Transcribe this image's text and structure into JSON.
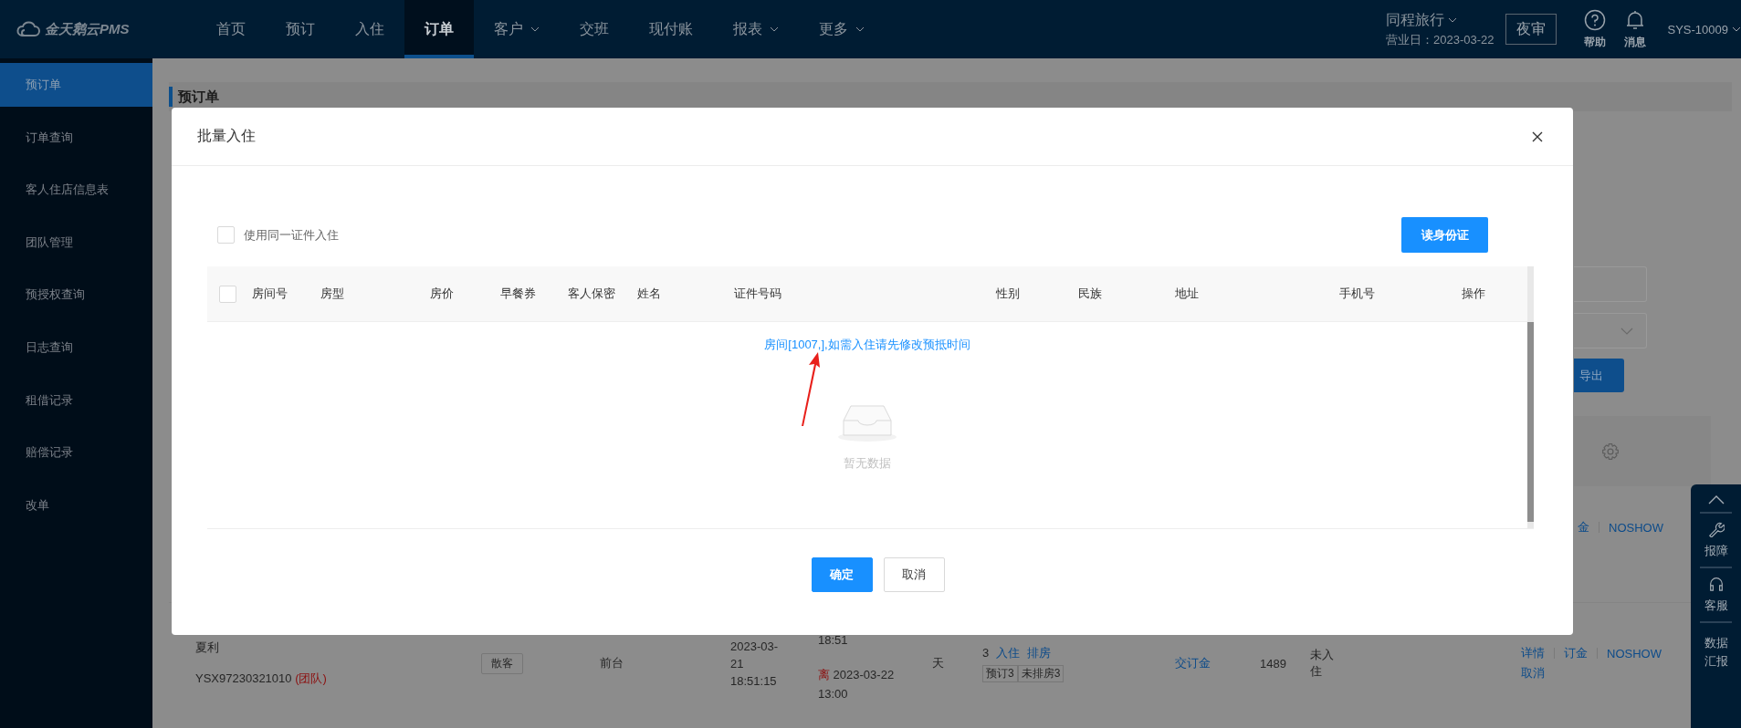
{
  "top_bar": {
    "logo": "金天鹅云PMS",
    "nav": [
      {
        "label": "首页",
        "selected": false,
        "has_menu": false
      },
      {
        "label": "预订",
        "selected": false,
        "has_menu": false
      },
      {
        "label": "入住",
        "selected": false,
        "has_menu": false
      },
      {
        "label": "订单",
        "selected": true,
        "has_menu": false
      },
      {
        "label": "客户",
        "selected": false,
        "has_menu": true
      },
      {
        "label": "交班",
        "selected": false,
        "has_menu": false
      },
      {
        "label": "现付账",
        "selected": false,
        "has_menu": false
      },
      {
        "label": "报表",
        "selected": false,
        "has_menu": true
      },
      {
        "label": "更多",
        "selected": false,
        "has_menu": true
      }
    ],
    "hotel": "同程旅行",
    "business_date": "营业日：2023-03-22",
    "night_audit_button": "夜审",
    "help": "帮助",
    "messages": "消息",
    "user": "SYS-10009"
  },
  "sidebar": {
    "items": [
      {
        "label": "预订单",
        "selected": true
      },
      {
        "label": "订单查询",
        "selected": false
      },
      {
        "label": "客人住店信息表",
        "selected": false
      },
      {
        "label": "团队管理",
        "selected": false
      },
      {
        "label": "预授权查询",
        "selected": false
      },
      {
        "label": "日志查询",
        "selected": false
      },
      {
        "label": "租借记录",
        "selected": false
      },
      {
        "label": "赔偿记录",
        "selected": false
      },
      {
        "label": "改单",
        "selected": false
      }
    ]
  },
  "page": {
    "title": "预订单",
    "export_button": "导出",
    "row_actions": [
      "金",
      "NOSHOW"
    ],
    "order_row": {
      "name": "夏利",
      "order_no": "YSX97230321010",
      "group_tag": "(团队)",
      "guest_type": "散客",
      "source": "前台",
      "created_lines": [
        "2023-03-",
        "21",
        "18:51:15"
      ],
      "arrival_tail": "18:51",
      "departure_mark": "离",
      "departure_lines": [
        "2023-03-22",
        "13:00"
      ],
      "nights_unit": "天",
      "room_count": "3",
      "room_actions": [
        "入住",
        "排房"
      ],
      "room_tags": [
        "预订3",
        "未排房3"
      ],
      "deposit_link": "交订金",
      "amount": "1489",
      "status": "未入住",
      "actions": [
        "详情",
        "订金",
        "NOSHOW"
      ],
      "cancel": "取消"
    }
  },
  "modal": {
    "title": "批量入住",
    "same_id": {
      "label": "使用同一证件入住",
      "checked": false
    },
    "read_id_button": "读身份证",
    "table": {
      "select_all_checked": false,
      "columns": [
        "房间号",
        "房型",
        "房价",
        "早餐券",
        "客人保密",
        "姓名",
        "证件号码",
        "性别",
        "民族",
        "地址",
        "手机号",
        "操作"
      ],
      "message": "房间[1007,],如需入住请先修改预抵时间",
      "empty_text": "暂无数据"
    },
    "buttons": [
      {
        "label": "确定",
        "kind": "primary"
      },
      {
        "label": "取消",
        "kind": "default"
      }
    ]
  },
  "float_panel": {
    "items": [
      {
        "kind": "top"
      },
      {
        "kind": "wrench",
        "label": "报障"
      },
      {
        "kind": "headset",
        "label": "客服"
      },
      {
        "kind": "text",
        "label": "数据汇报"
      }
    ]
  }
}
